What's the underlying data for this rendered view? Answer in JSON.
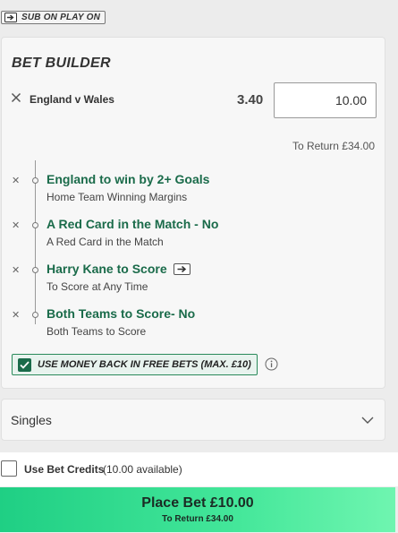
{
  "sub_on_play_on": "SUB ON PLAY ON",
  "bet_builder": {
    "title": "BET BUILDER",
    "match": "England v Wales",
    "odds": "3.40",
    "stake": "10.00",
    "to_return": "To Return £34.00",
    "selections": [
      {
        "title": "England to win by 2+ Goals",
        "market": "Home Team Winning Margins"
      },
      {
        "title": "A Red Card in the Match - No",
        "market": "A Red Card in the Match"
      },
      {
        "title": "Harry Kane to Score",
        "market": "To Score at Any Time",
        "sub_icon": "sub-on-icon"
      },
      {
        "title": "Both Teams to Score- No",
        "market": "Both Teams to Score"
      }
    ],
    "money_back": {
      "label": "USE MONEY BACK IN FREE BETS (MAX. £10)",
      "checked": true
    }
  },
  "singles": {
    "label": "Singles"
  },
  "bet_credits": {
    "label": "Use Bet Credits",
    "available": "(10.00 available)",
    "checked": false
  },
  "place_bet": {
    "label": "Place Bet  £10.00",
    "to_return": "To Return £34.00"
  },
  "colors": {
    "accent_green": "#1a6b4a",
    "button_green": "#44e79a"
  }
}
